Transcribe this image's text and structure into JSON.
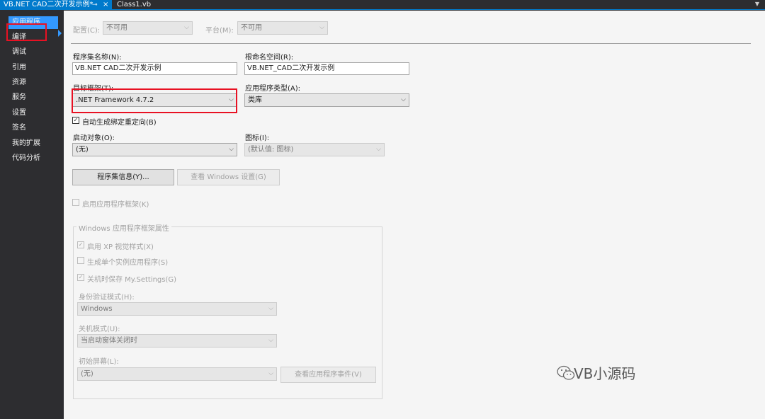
{
  "tabs": {
    "active_title": "VB.NET CAD二次开发示例*",
    "pin_icon": "⊸",
    "close_icon": "×",
    "second_title": "Class1.vb",
    "menu_icon": "▼"
  },
  "sidebar": {
    "items": [
      "应用程序",
      "编译",
      "调试",
      "引用",
      "资源",
      "服务",
      "设置",
      "签名",
      "我的扩展",
      "代码分析"
    ],
    "selected": "应用程序"
  },
  "top": {
    "config_label": "配置(C):",
    "config_value": "不可用",
    "platform_label": "平台(M):",
    "platform_value": "不可用"
  },
  "assembly": {
    "name_label": "程序集名称(N):",
    "name_value": "VB.NET CAD二次开发示例",
    "root_ns_label": "根命名空间(R):",
    "root_ns_value": "VB.NET_CAD二次开发示例",
    "target_fw_label": "目标框架(T):",
    "target_fw_value": ".NET Framework 4.7.2",
    "app_type_label": "应用程序类型(A):",
    "app_type_value": "类库",
    "auto_redirect_label": "自动生成绑定重定向(B)",
    "auto_redirect_checked": true,
    "startup_label": "启动对象(O):",
    "startup_value": "(无)",
    "icon_label": "图标(I):",
    "icon_value": "(默认值: 图标)",
    "assembly_info_button": "程序集信息(Y)...",
    "view_windows_settings_button": "查看 Windows 设置(G)",
    "enable_framework_label": "启用应用程序框架(K)",
    "enable_framework_checked": false
  },
  "windows_framework": {
    "group_title": "Windows 应用程序框架属性",
    "xp_styles_label": "启用 XP 视觉样式(X)",
    "xp_styles_checked": true,
    "single_instance_label": "生成单个实例应用程序(S)",
    "single_instance_checked": false,
    "save_settings_label": "关机时保存 My.Settings(G)",
    "save_settings_checked": true,
    "auth_mode_label": "身份验证模式(H):",
    "auth_mode_value": "Windows",
    "shutdown_mode_label": "关机模式(U):",
    "shutdown_mode_value": "当启动窗体关闭时",
    "splash_label": "初始屏幕(L):",
    "splash_value": "(无)",
    "view_events_button": "查看应用程序事件(V)"
  },
  "watermark": {
    "text": "VB小源码",
    "icon": "wechat-icon"
  },
  "colors": {
    "accent": "#007acc",
    "sidebar_selected": "#3399ff",
    "highlight_box": "#e81123",
    "panel_bg": "#f5f5f5",
    "ide_dark": "#2d2d30"
  }
}
